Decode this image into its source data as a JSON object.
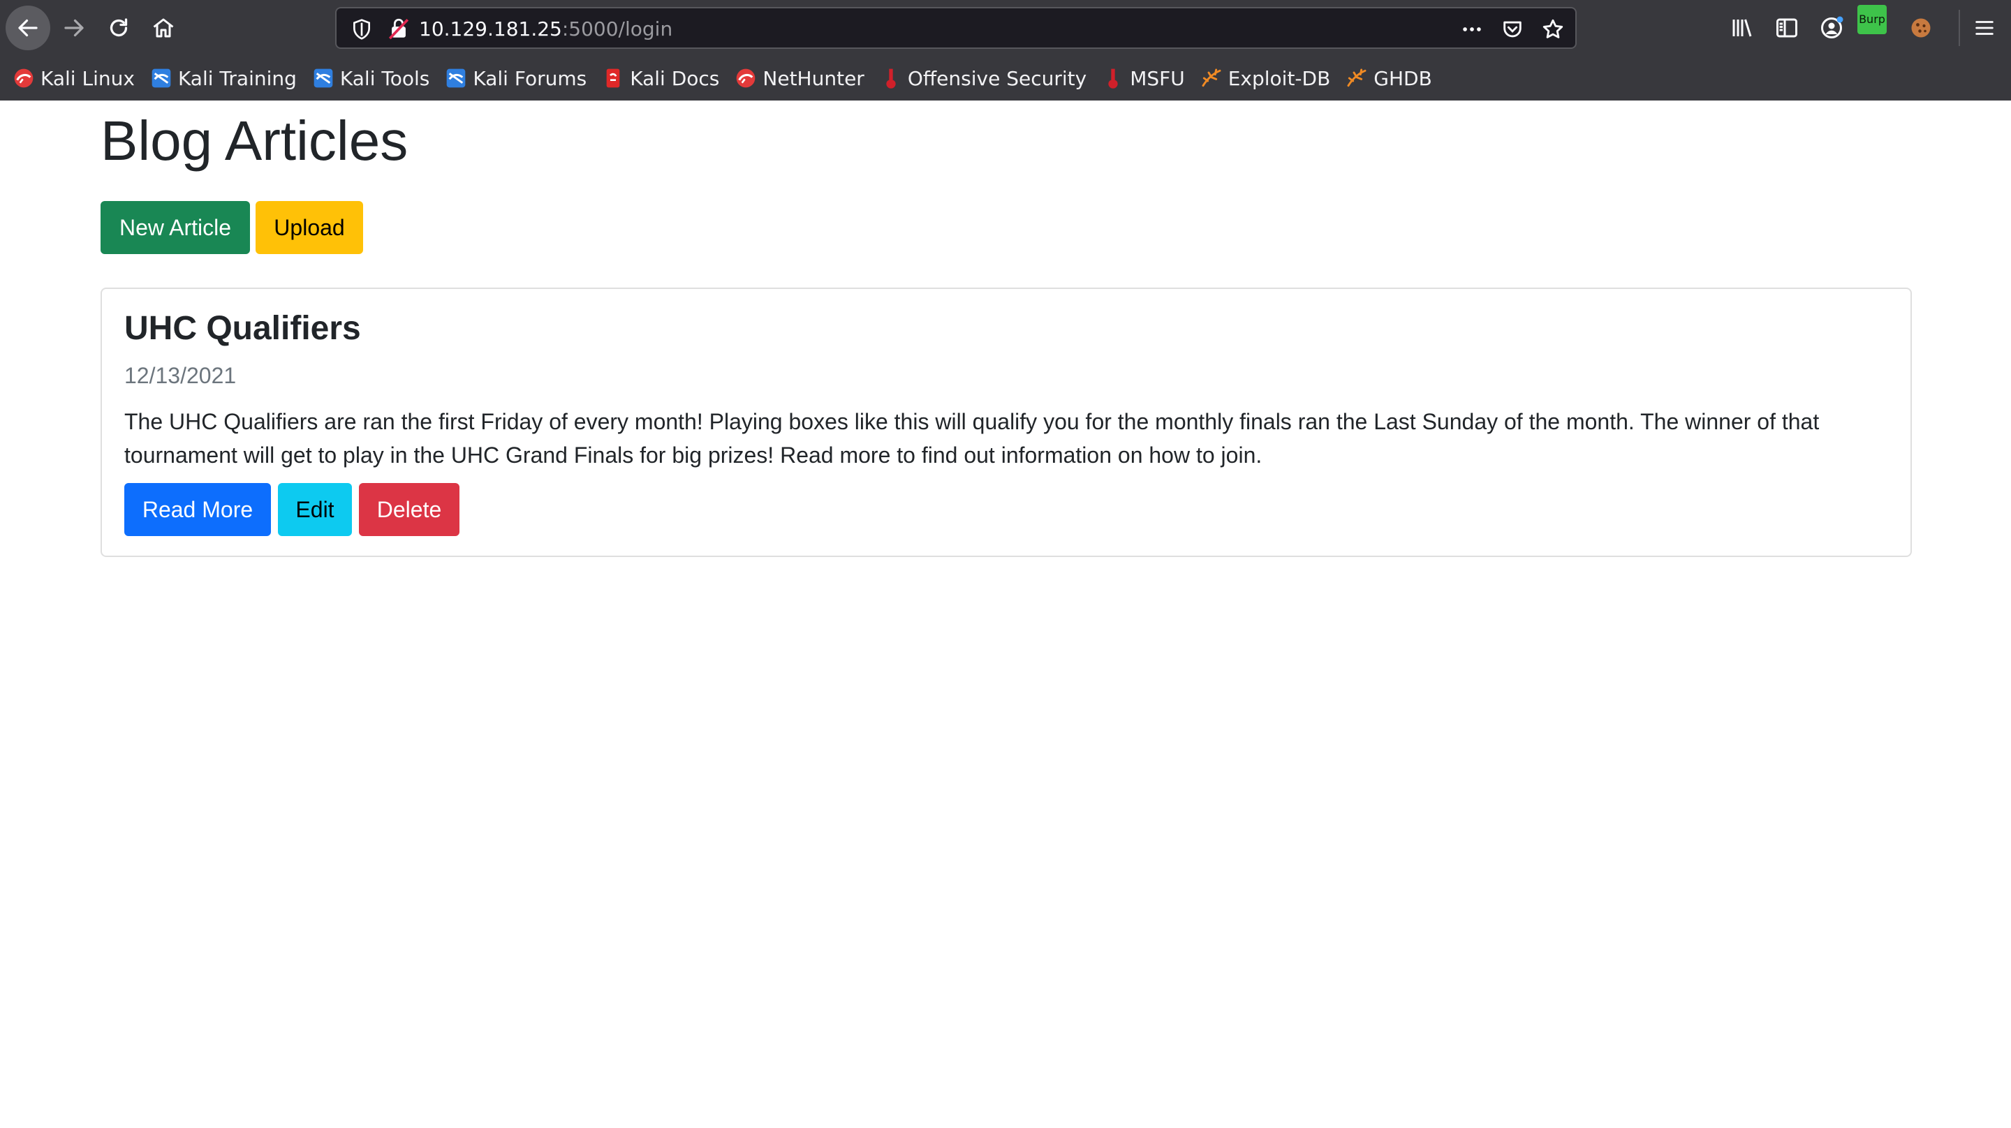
{
  "browser": {
    "url": {
      "host": "10.129.181.25",
      "path": ":5000/login"
    },
    "burp_badge": "Burp",
    "bookmarks": [
      {
        "label": "Kali Linux",
        "icon": "kali-dragon-icon"
      },
      {
        "label": "Kali Training",
        "icon": "kali-training-icon"
      },
      {
        "label": "Kali Tools",
        "icon": "kali-tools-icon"
      },
      {
        "label": "Kali Forums",
        "icon": "kali-forums-icon"
      },
      {
        "label": "Kali Docs",
        "icon": "kali-docs-icon"
      },
      {
        "label": "NetHunter",
        "icon": "nethunter-icon"
      },
      {
        "label": "Offensive Security",
        "icon": "offsec-icon"
      },
      {
        "label": "MSFU",
        "icon": "msfu-icon"
      },
      {
        "label": "Exploit-DB",
        "icon": "exploit-db-icon"
      },
      {
        "label": "GHDB",
        "icon": "ghdb-icon"
      }
    ]
  },
  "page": {
    "title": "Blog Articles",
    "actions": {
      "new_article": "New Article",
      "upload": "Upload"
    },
    "articles": [
      {
        "title": "UHC Qualifiers",
        "date": "12/13/2021",
        "body": "The UHC Qualifiers are ran the first Friday of every month! Playing boxes like this will qualify you for the monthly finals ran the Last Sunday of the month. The winner of that tournament will get to play in the UHC Grand Finals for big prizes! Read more to find out information on how to join.",
        "read_more": "Read More",
        "edit": "Edit",
        "delete": "Delete"
      }
    ]
  },
  "colors": {
    "success": "#198754",
    "warning": "#ffc107",
    "primary": "#0d6efd",
    "info": "#0dcaf0",
    "danger": "#dc3545",
    "chrome": "#38383d"
  }
}
